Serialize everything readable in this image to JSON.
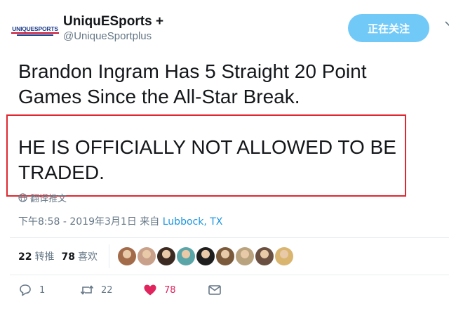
{
  "user": {
    "display_name": "UniquESports +",
    "handle": "@UniqueSportplus",
    "avatar_text": "UNIQUESPORTS"
  },
  "follow_button": {
    "label": "正在关注"
  },
  "tweet": {
    "line1": "Brandon Ingram Has 5 Straight 20 Point Games Since the All-Star Break.",
    "line2": "HE IS OFFICIALLY NOT ALLOWED TO BE TRADED."
  },
  "translate": {
    "label": "翻译推文"
  },
  "meta": {
    "timestamp": "下午8:58 - 2019年3月1日 来自",
    "location": "Lubbock, TX"
  },
  "stats": {
    "retweets_count": "22",
    "retweets_label": "转推",
    "likes_count": "78",
    "likes_label": "喜欢"
  },
  "likers": [
    {
      "name": "liker-1",
      "color": "#a36b4a"
    },
    {
      "name": "liker-2",
      "color": "#c9a08a"
    },
    {
      "name": "liker-3",
      "color": "#3a2a22"
    },
    {
      "name": "liker-4",
      "color": "#5aa5a8"
    },
    {
      "name": "liker-5",
      "color": "#1e1e1e"
    },
    {
      "name": "liker-6",
      "color": "#7a5a3a"
    },
    {
      "name": "liker-7",
      "color": "#b9a37e"
    },
    {
      "name": "liker-8",
      "color": "#6a5040"
    },
    {
      "name": "liker-9",
      "color": "#d9b570"
    }
  ],
  "actions": {
    "reply_count": "1",
    "retweet_count": "22",
    "like_count": "78"
  },
  "colors": {
    "accent": "#1b95e0",
    "follow_bg": "#71c9f8",
    "like": "#e0245e",
    "highlight_box": "#e0272f"
  }
}
